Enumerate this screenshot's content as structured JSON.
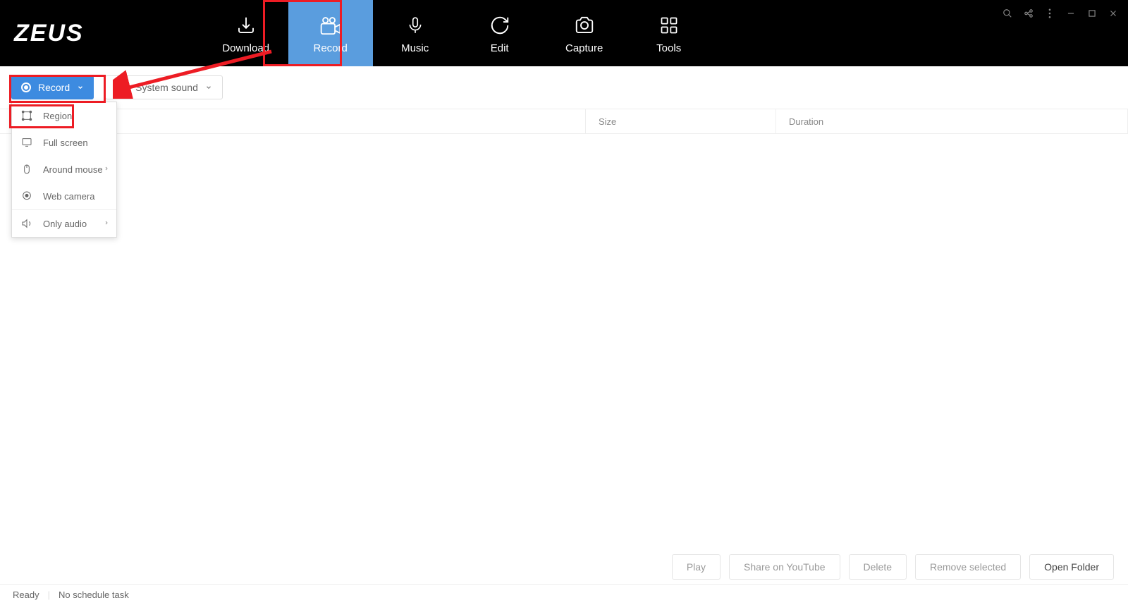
{
  "app": {
    "name": "ZEUS"
  },
  "nav": {
    "tabs": [
      {
        "label": "Download"
      },
      {
        "label": "Record"
      },
      {
        "label": "Music"
      },
      {
        "label": "Edit"
      },
      {
        "label": "Capture"
      },
      {
        "label": "Tools"
      }
    ]
  },
  "toolbar": {
    "record_label": "Record",
    "sound_label": "System sound"
  },
  "dropdown": {
    "items": [
      {
        "label": "Region"
      },
      {
        "label": "Full screen"
      },
      {
        "label": "Around mouse"
      },
      {
        "label": "Web camera"
      },
      {
        "label": "Only audio"
      }
    ]
  },
  "table": {
    "columns": {
      "name": "",
      "size": "Size",
      "duration": "Duration"
    }
  },
  "actions": {
    "play": "Play",
    "share": "Share on YouTube",
    "delete": "Delete",
    "remove": "Remove selected",
    "open_folder": "Open Folder"
  },
  "status": {
    "ready": "Ready",
    "schedule": "No schedule task"
  }
}
